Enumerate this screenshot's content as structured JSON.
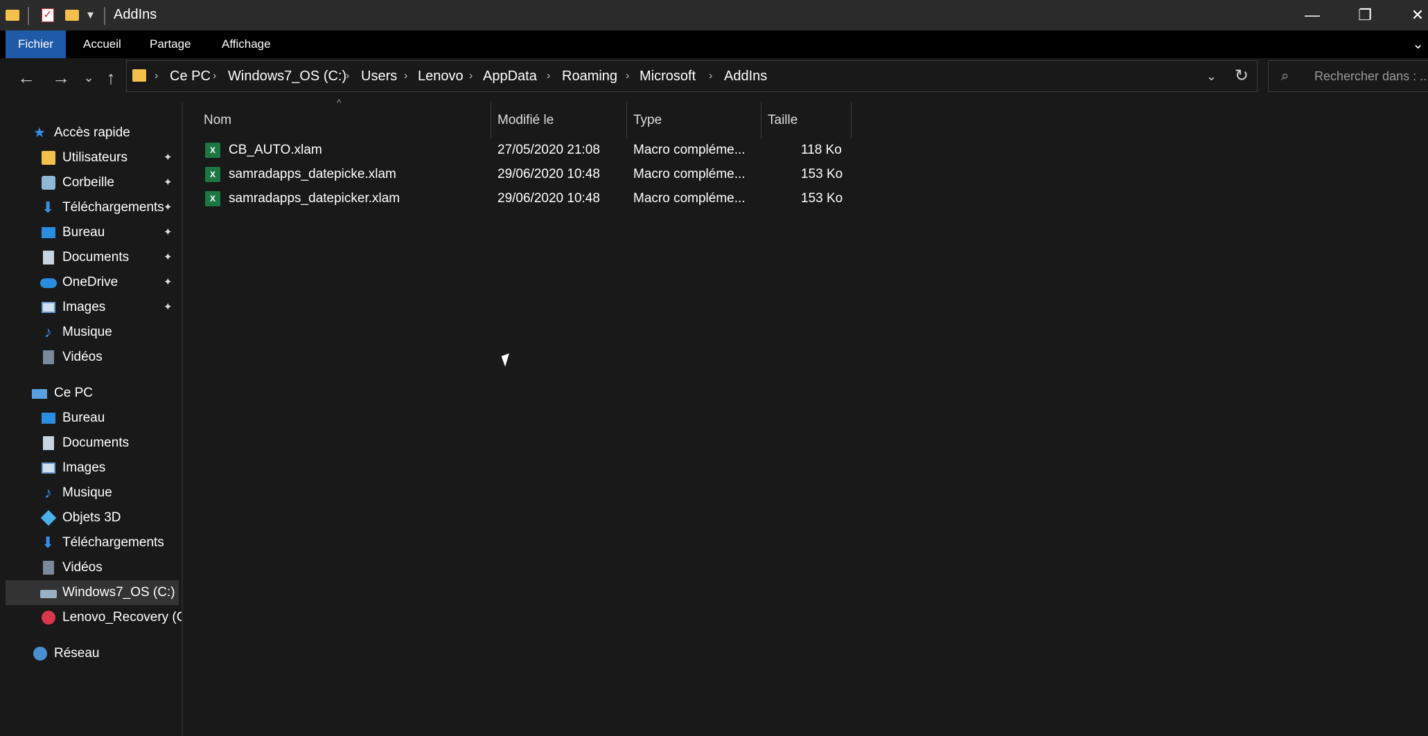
{
  "window": {
    "title": "AddIns",
    "controls": {
      "minimize": "—",
      "maximize": "❐",
      "close": "✕"
    }
  },
  "ribbon": {
    "tabs": [
      {
        "label": "Fichier",
        "active": true
      },
      {
        "label": "Accueil"
      },
      {
        "label": "Partage"
      },
      {
        "label": "Affichage"
      }
    ],
    "expand_glyph": "⌄"
  },
  "nav": {
    "back": "←",
    "forward": "→",
    "recent": "⌄",
    "up": "↑"
  },
  "address": {
    "crumbs": [
      "Ce PC",
      "Windows7_OS (C:)",
      "Users",
      "Lenovo",
      "AppData",
      "Roaming",
      "Microsoft",
      "AddIns"
    ],
    "separator": "›",
    "dropdown": "⌄",
    "refresh": "↻"
  },
  "search": {
    "placeholder": "Rechercher dans : ..."
  },
  "navpane": {
    "quick_access": {
      "label": "Accès rapide",
      "items": [
        {
          "label": "Utilisateurs",
          "icon": "folder-icon",
          "pinned": true
        },
        {
          "label": "Corbeille",
          "icon": "recycle-bin-icon",
          "pinned": true
        },
        {
          "label": "Téléchargements",
          "icon": "download-icon",
          "pinned": true
        },
        {
          "label": "Bureau",
          "icon": "desktop-icon",
          "pinned": true
        },
        {
          "label": "Documents",
          "icon": "documents-icon",
          "pinned": true
        },
        {
          "label": "OneDrive",
          "icon": "cloud-icon",
          "pinned": true
        },
        {
          "label": "Images",
          "icon": "images-icon",
          "pinned": true
        },
        {
          "label": "Musique",
          "icon": "music-icon",
          "pinned": false
        },
        {
          "label": "Vidéos",
          "icon": "videos-icon",
          "pinned": false
        }
      ]
    },
    "this_pc": {
      "label": "Ce PC",
      "items": [
        {
          "label": "Bureau",
          "icon": "desktop-icon"
        },
        {
          "label": "Documents",
          "icon": "documents-icon"
        },
        {
          "label": "Images",
          "icon": "images-icon"
        },
        {
          "label": "Musique",
          "icon": "music-icon"
        },
        {
          "label": "Objets 3D",
          "icon": "cube-icon"
        },
        {
          "label": "Téléchargements",
          "icon": "download-icon"
        },
        {
          "label": "Vidéos",
          "icon": "videos-icon"
        },
        {
          "label": "Windows7_OS (C:)",
          "icon": "drive-icon",
          "selected": true
        },
        {
          "label": "Lenovo_Recovery (C",
          "icon": "recovery-drive-icon"
        }
      ]
    },
    "network": {
      "label": "Réseau"
    },
    "pin_glyph": "📌"
  },
  "files": {
    "columns": [
      "Nom",
      "Modifié le",
      "Type",
      "Taille"
    ],
    "rows": [
      {
        "name": "CB_AUTO.xlam",
        "modified": "27/05/2020 21:08",
        "type": "Macro compléme...",
        "size": "118 Ko"
      },
      {
        "name": "samradapps_datepicke.xlam",
        "modified": "29/06/2020 10:48",
        "type": "Macro compléme...",
        "size": "153 Ko"
      },
      {
        "name": "samradapps_datepicker.xlam",
        "modified": "29/06/2020 10:48",
        "type": "Macro compléme...",
        "size": "153 Ko"
      }
    ],
    "icon_glyph": "X"
  },
  "colors": {
    "accent_tab": "#1f5aa8",
    "folder": "#f3c14b",
    "excel": "#1d7745",
    "background": "#191919"
  }
}
